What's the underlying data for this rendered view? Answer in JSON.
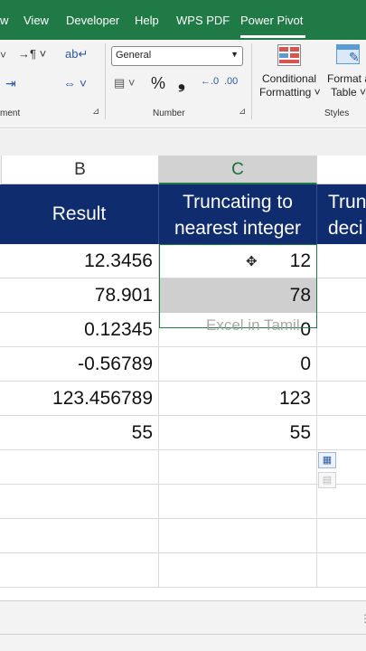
{
  "menu": [
    "w",
    "View",
    "Developer",
    "Help",
    "WPS PDF",
    "Power Pivot"
  ],
  "ribbon": {
    "alignment_group_label": "ment",
    "number_format_value": "General",
    "number_group_label": "Number",
    "currency_symbol": "%",
    "comma_symbol": "❟",
    "conditional_formatting_line1": "Conditional",
    "conditional_formatting_line2": "Formatting ˅",
    "format_as_table_line1": "Format a",
    "format_as_table_line2": "Table ˅",
    "styles_group_label": "Styles"
  },
  "column_headers": [
    "B",
    "C"
  ],
  "table": {
    "headers": {
      "result": "Result",
      "trunc_line1": "Truncating to",
      "trunc_line2": "nearest integer",
      "next_line1": "Trun",
      "next_line2": "deci"
    },
    "rows": [
      {
        "result": "12.3456",
        "truncated": "12"
      },
      {
        "result": "78.901",
        "truncated": "78"
      },
      {
        "result": "0.12345",
        "truncated": "0"
      },
      {
        "result": "-0.56789",
        "truncated": "0"
      },
      {
        "result": "123.456789",
        "truncated": "123"
      },
      {
        "result": "55",
        "truncated": "55"
      }
    ]
  },
  "watermark": "Excel in Tamil",
  "colors": {
    "title_bar": "#1f7a45",
    "header_fill": "#0f2d6e",
    "selection_border": "#1f7a45"
  }
}
